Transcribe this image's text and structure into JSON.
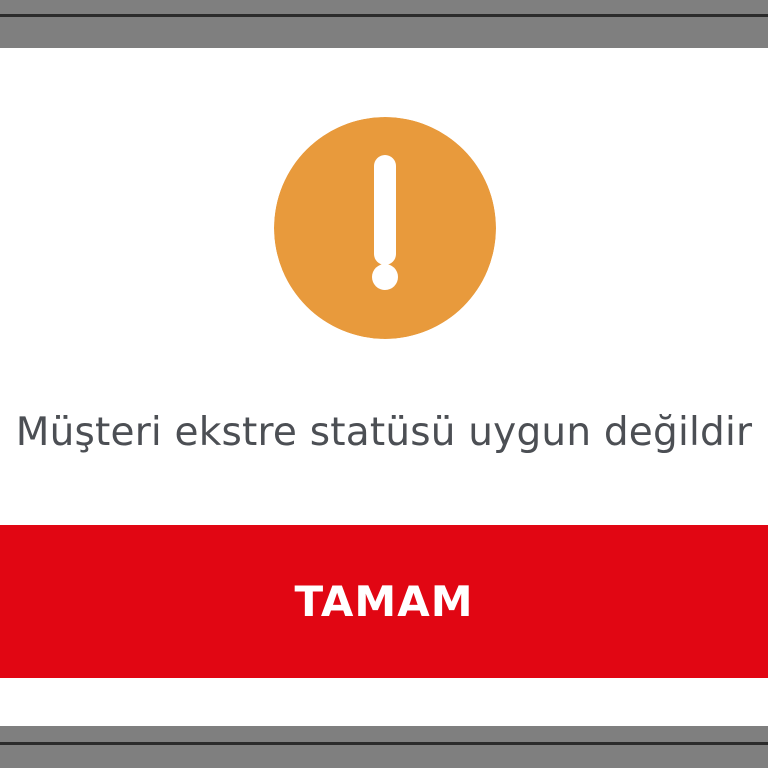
{
  "colors": {
    "backdrop": "#7f7f7f",
    "dialog_background": "#ffffff",
    "warning_circle": "#e89a3c",
    "message_text": "#4c4f54",
    "button_background": "#e10613",
    "button_text": "#ffffff"
  },
  "dialog": {
    "icon": "exclamation-warning-icon",
    "message": "Müşteri ekstre statüsü uygun değildir",
    "ok_button_label": "TAMAM"
  }
}
